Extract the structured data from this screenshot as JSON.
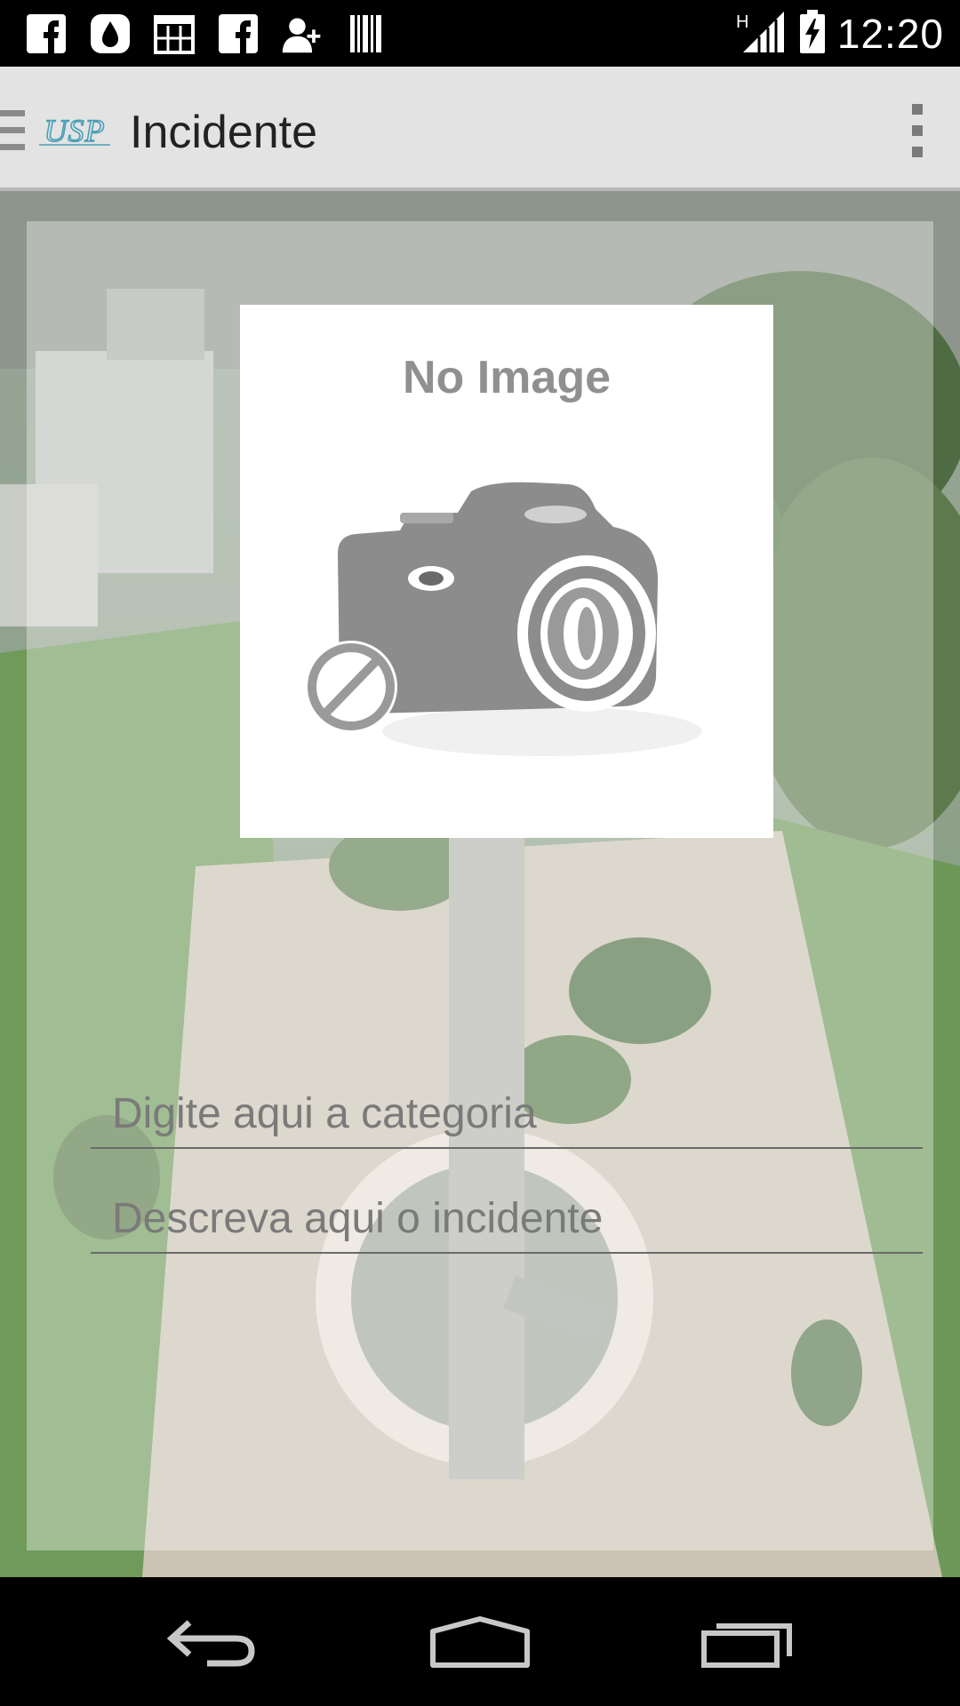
{
  "status_bar": {
    "time": "12:20",
    "network_type": "H",
    "notification_icons": [
      "facebook-icon",
      "droplet-icon",
      "calendar-icon",
      "facebook-icon",
      "add-contact-icon",
      "barcode-icon"
    ]
  },
  "action_bar": {
    "logo_text": "USP",
    "title": "Incidente"
  },
  "form": {
    "image_placeholder_text": "No Image",
    "categoria": {
      "value": "",
      "placeholder": "Digite aqui a categoria"
    },
    "incidente": {
      "value": "",
      "placeholder": "Descreva aqui o incidente"
    }
  },
  "colors": {
    "action_bar_bg": "#e3e3e3",
    "logo_color": "#4a9fb5",
    "status_bar_bg": "#000000"
  }
}
